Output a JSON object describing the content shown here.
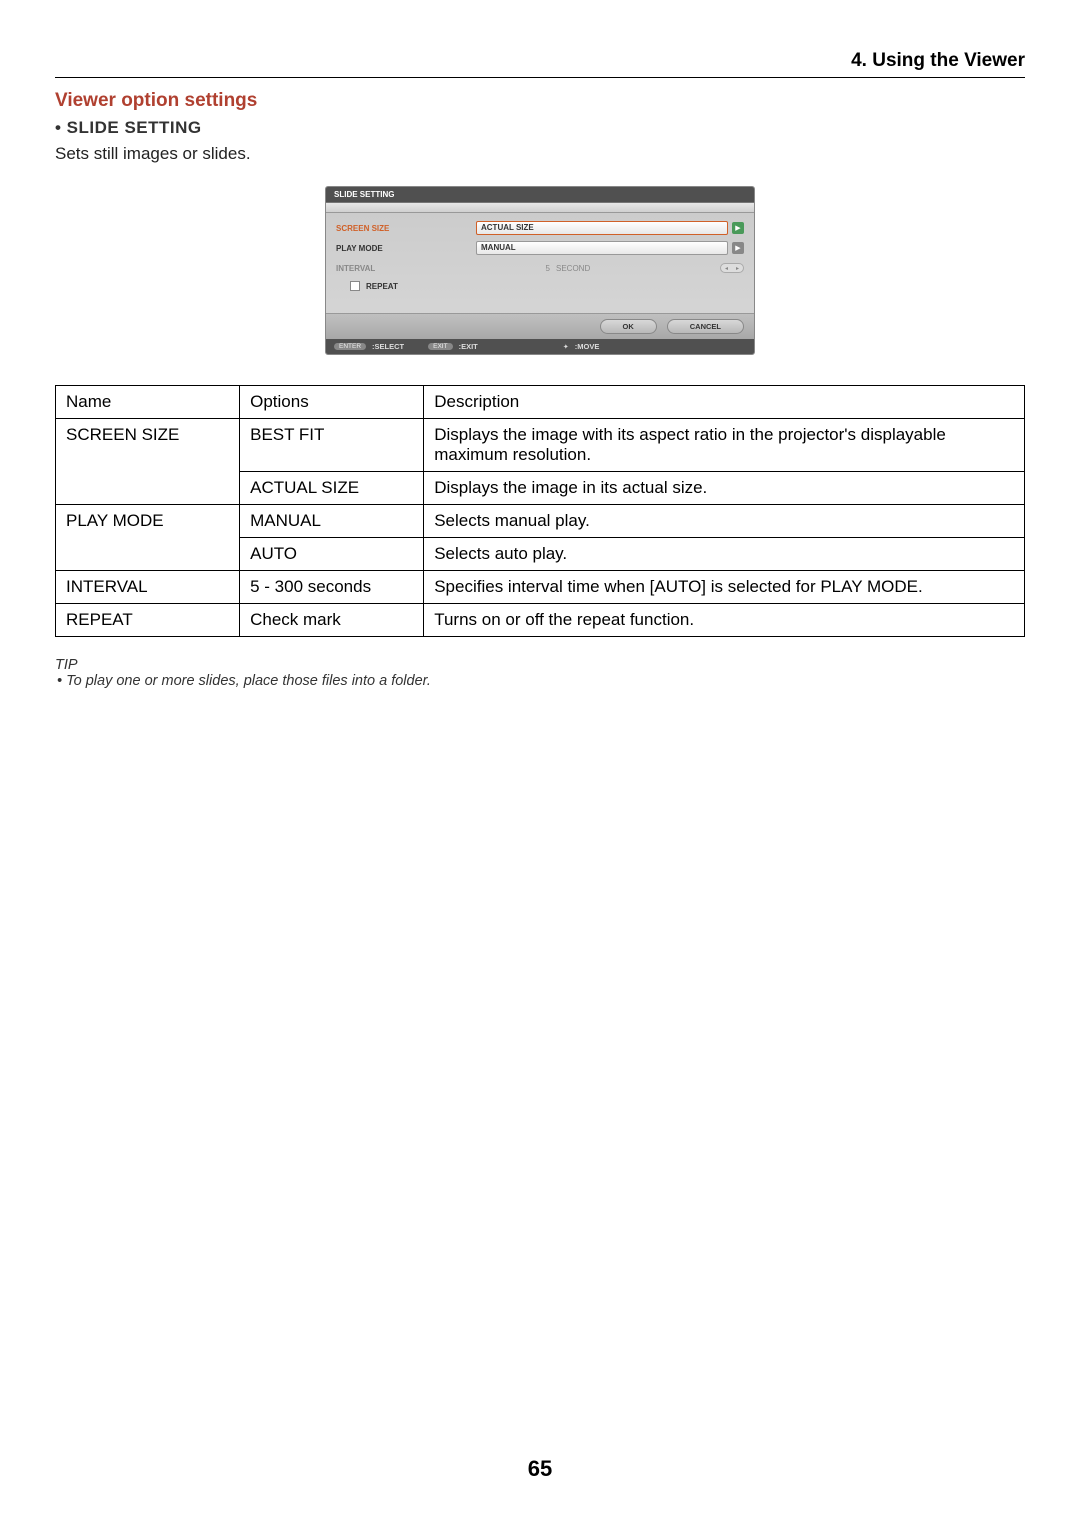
{
  "header": {
    "chapter": "4. Using the Viewer"
  },
  "section": {
    "title": "Viewer option settings",
    "subtitle": "• SLIDE SETTING",
    "description": "Sets still images or slides."
  },
  "panel": {
    "title": "SLIDE SETTING",
    "rows": {
      "screen_size": {
        "label": "SCREEN SIZE",
        "value": "ACTUAL SIZE"
      },
      "play_mode": {
        "label": "PLAY MODE",
        "value": "MANUAL"
      },
      "interval": {
        "label": "INTERVAL",
        "value": "5",
        "unit": "SECOND"
      },
      "repeat": {
        "label": "REPEAT"
      }
    },
    "buttons": {
      "ok": "OK",
      "cancel": "CANCEL"
    },
    "footer": {
      "enter_pill": "ENTER",
      "select": ":SELECT",
      "exit_pill": "EXIT",
      "exit": ":EXIT",
      "move_icon": "✦",
      "move": ":MOVE"
    }
  },
  "table": {
    "headers": {
      "name": "Name",
      "options": "Options",
      "description": "Description"
    },
    "rows": [
      {
        "name": "SCREEN SIZE",
        "option": "BEST FIT",
        "desc": "Displays the image with its aspect ratio in the projector's displayable maximum resolution."
      },
      {
        "name": "",
        "option": "ACTUAL SIZE",
        "desc": "Displays the image in its actual size."
      },
      {
        "name": "PLAY MODE",
        "option": "MANUAL",
        "desc": "Selects manual play."
      },
      {
        "name": "",
        "option": "AUTO",
        "desc": "Selects auto play."
      },
      {
        "name": "INTERVAL",
        "option": "5 - 300 seconds",
        "desc": "Specifies interval time when [AUTO] is selected for PLAY MODE."
      },
      {
        "name": "REPEAT",
        "option": "Check mark",
        "desc": "Turns on or off the repeat function."
      }
    ]
  },
  "tip": {
    "label": "TIP",
    "text": "•  To play one or more slides, place those files into a folder."
  },
  "page_number": "65"
}
